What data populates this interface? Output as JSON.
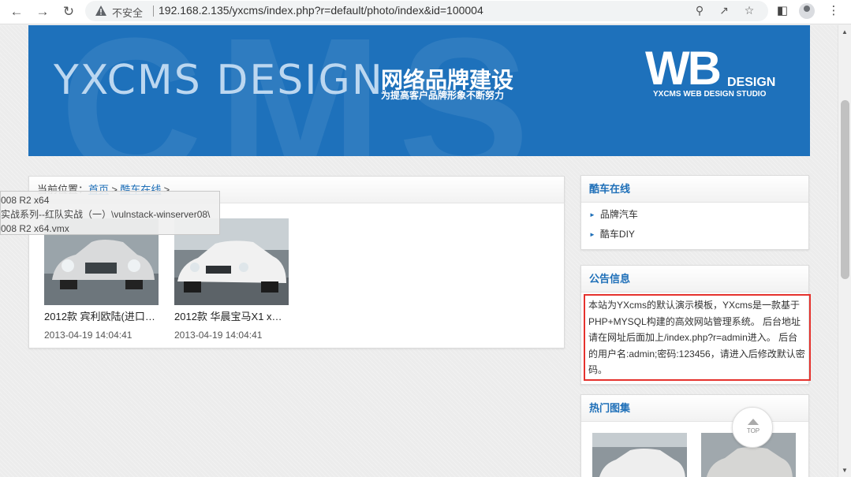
{
  "browser": {
    "security_label": "不安全",
    "url": "192.168.2.135/yxcms/index.php?r=default/photo/index&id=100004"
  },
  "banner": {
    "brand": "YXCMS DESIGN",
    "title_cn": "网络品牌建设",
    "subtitle_cn": "为提高客户品牌形象不断努力",
    "logo_wb": "WB",
    "logo_design": "DESIGN",
    "logo_sub": "YXCMS WEB DESIGN STUDIO",
    "bg_text": "CMS"
  },
  "breadcrumb": {
    "label": "当前位置：",
    "home": "首页",
    "sep": ">",
    "category": "酷车在线",
    "trail": ">"
  },
  "tooltip": {
    "lines": [
      "008 R2 x64",
      "实战系列--红队实战（一）\\vulnstack-winserver08\\",
      "008 R2 x64.vmx"
    ]
  },
  "photos": [
    {
      "title": "2012款 宾利欧陆(进口…",
      "date": "2013-04-19 14:04:41"
    },
    {
      "title": "2012款 华晨宝马X1 x…",
      "date": "2013-04-19 14:04:41"
    }
  ],
  "sidebar": {
    "cars": {
      "title": "酷车在线",
      "items": [
        "品牌汽车",
        "酷车DIY"
      ]
    },
    "notice": {
      "title": "公告信息",
      "text": "本站为YXcms的默认演示模板，YXcms是一款基于PHP+MYSQL构建的高效网站管理系统。 后台地址请在网址后面加上/index.php?r=admin进入。 后台的用户名:admin;密码:123456，请进入后修改默认密码。"
    },
    "gallery": {
      "title": "热门图集"
    }
  },
  "top_button": {
    "label": "TOP"
  }
}
